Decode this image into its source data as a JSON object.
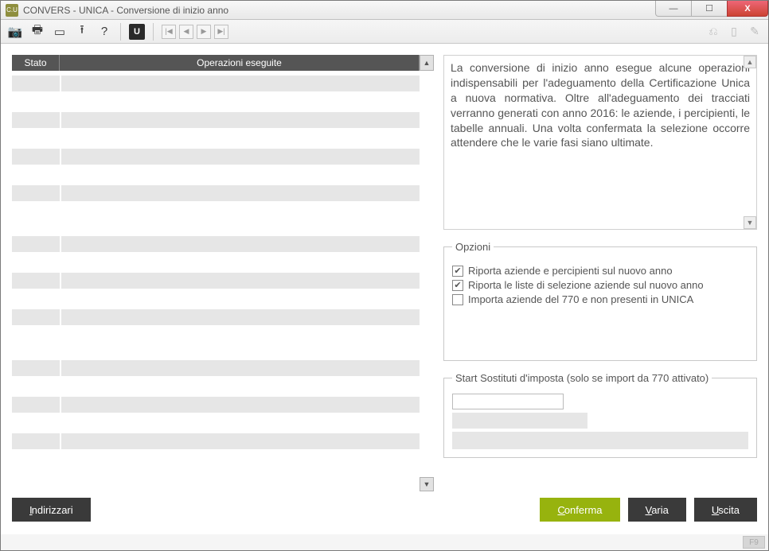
{
  "window": {
    "app_icon_text": "C.U",
    "title": "CONVERS  - UNICA -   Conversione di inizio anno"
  },
  "titlebar_controls": {
    "minimize": "—",
    "maximize": "☐",
    "close": "X"
  },
  "toolbar": {
    "camera": "📷",
    "print": "🖶",
    "folder": "▭",
    "upload": "⭱",
    "help": "?",
    "badge": "U",
    "first": "|◀",
    "prev": "◀",
    "next": "▶",
    "last": "▶|",
    "right1": "⎌",
    "right2": "▯",
    "right3": "✎"
  },
  "table": {
    "col_stato": "Stato",
    "col_op": "Operazioni eseguite",
    "scroll_up": "▲",
    "scroll_down": "▼"
  },
  "description": "La conversione di inizio anno esegue alcune operazioni indispensabili per l'adeguamento della Certificazione Unica a nuova normativa. Oltre all'adeguamento dei tracciati verranno generati con anno 2016: le aziende, i percipienti, le tabelle annuali. Una volta confermata la selezione occorre attendere che le varie fasi siano ultimate.",
  "options": {
    "legend": "Opzioni",
    "chk1": {
      "checked": true,
      "label": "Riporta aziende e percipienti sul nuovo anno"
    },
    "chk2": {
      "checked": true,
      "label": "Riporta le liste di selezione aziende sul nuovo anno"
    },
    "chk3": {
      "checked": false,
      "label": "Importa aziende del 770 e non presenti in UNICA"
    }
  },
  "start": {
    "legend": "Start Sostituti d'imposta (solo se import da 770 attivato)"
  },
  "buttons": {
    "indirizzari": "Indirizzari",
    "conferma": "Conferma",
    "varia": "Varia",
    "uscita": "Uscita"
  },
  "statusbar": {
    "fkey": "F9"
  },
  "check_glyph": "✔"
}
